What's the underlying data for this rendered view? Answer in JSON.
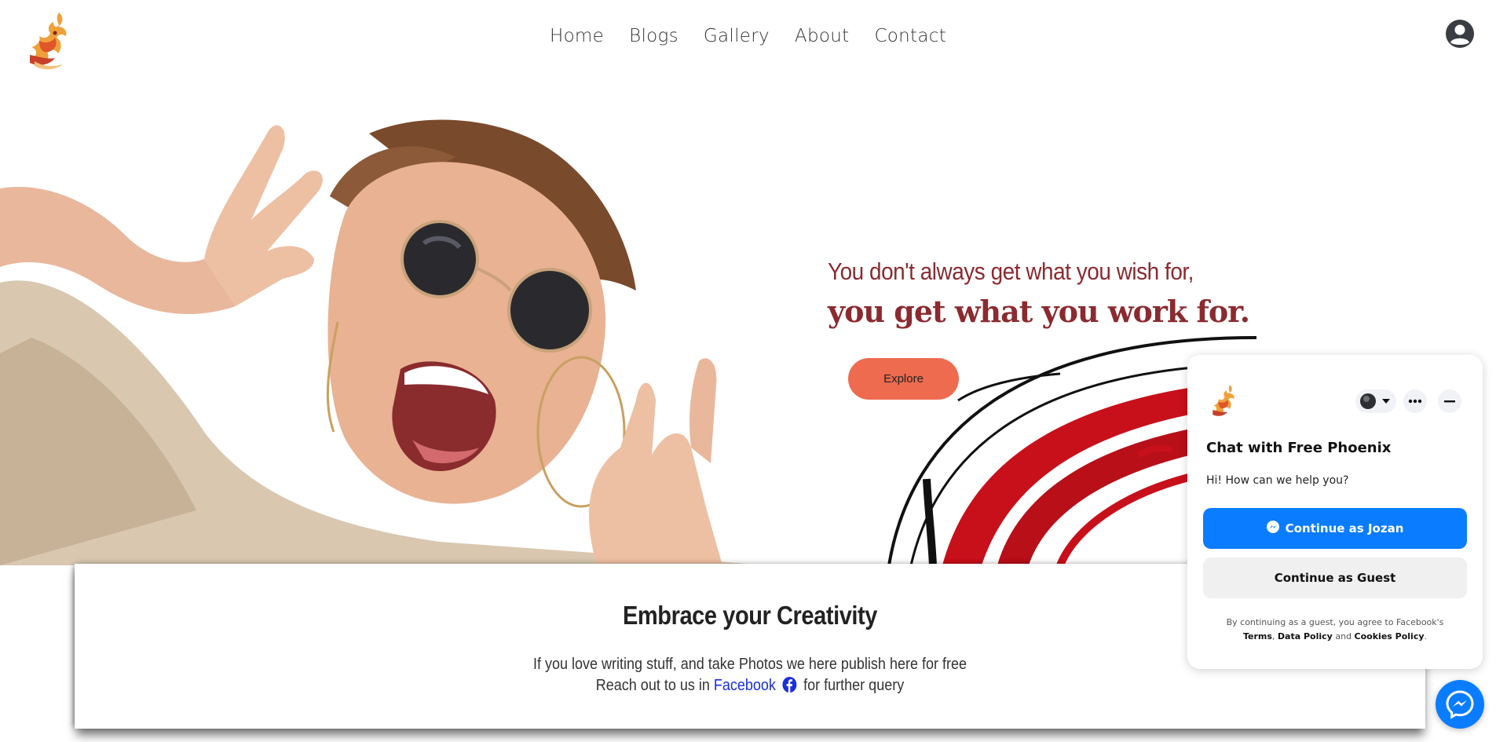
{
  "nav": {
    "items": [
      {
        "label": "Home"
      },
      {
        "label": "Blogs"
      },
      {
        "label": "Gallery"
      },
      {
        "label": "About"
      },
      {
        "label": "Contact"
      }
    ]
  },
  "icons": {
    "logo": "phoenix-logo",
    "account": "user-circle-icon",
    "messenger": "messenger-icon",
    "facebook": "facebook-icon"
  },
  "hero": {
    "quote_line1": "You don't always get what you wish for,",
    "quote_line2": "you get what you work for.",
    "explore_label": "Explore",
    "quote_color": "#8b2a2f",
    "button_color": "#ee6b4f"
  },
  "card": {
    "title": "Embrace your Creativity",
    "line1": "If you love writing stuff, and take Photos we here publish here for free",
    "line2_prefix": "Reach out to us in",
    "line2_link": "Facebook",
    "line2_suffix": "for further query"
  },
  "chat": {
    "title": "Chat with Free Phoenix",
    "greeting": "Hi! How can we help you?",
    "continue_user_label": "Continue as Jozan",
    "continue_guest_label": "Continue as Guest",
    "disclaimer_prefix": "By continuing as a guest, you agree to Facebook's",
    "terms_label": "Terms",
    "data_policy_label": "Data Policy",
    "and_text": "and",
    "cookies_label": "Cookies Policy",
    "accent": "#0a7cff"
  }
}
